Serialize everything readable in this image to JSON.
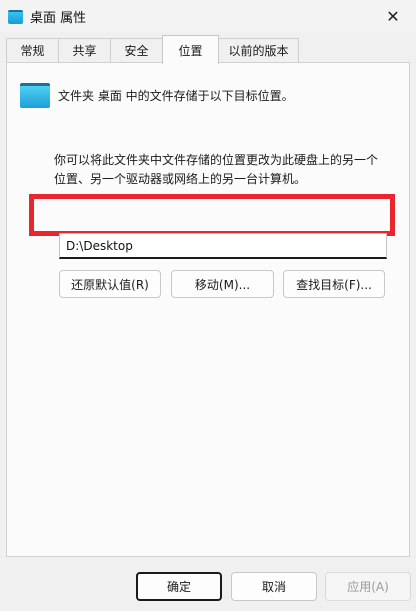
{
  "window": {
    "title": "桌面 属性",
    "close_glyph": "✕"
  },
  "tabs": [
    {
      "label": "常规"
    },
    {
      "label": "共享"
    },
    {
      "label": "安全"
    },
    {
      "label": "位置"
    },
    {
      "label": "以前的版本"
    }
  ],
  "active_tab": "位置",
  "location": {
    "info": "文件夹 桌面 中的文件存储于以下目标位置。",
    "description": "你可以将此文件夹中文件存储的位置更改为此硬盘上的另一个位置、另一个驱动器或网络上的另一台计算机。",
    "path_value": "D:\\Desktop",
    "buttons": {
      "restore": "还原默认值(R)",
      "move": "移动(M)...",
      "find_target": "查找目标(F)..."
    }
  },
  "footer": {
    "ok": "确定",
    "cancel": "取消",
    "apply": "应用(A)"
  },
  "colors": {
    "highlight": "#e8262e",
    "folder": "#1b9fd8"
  }
}
